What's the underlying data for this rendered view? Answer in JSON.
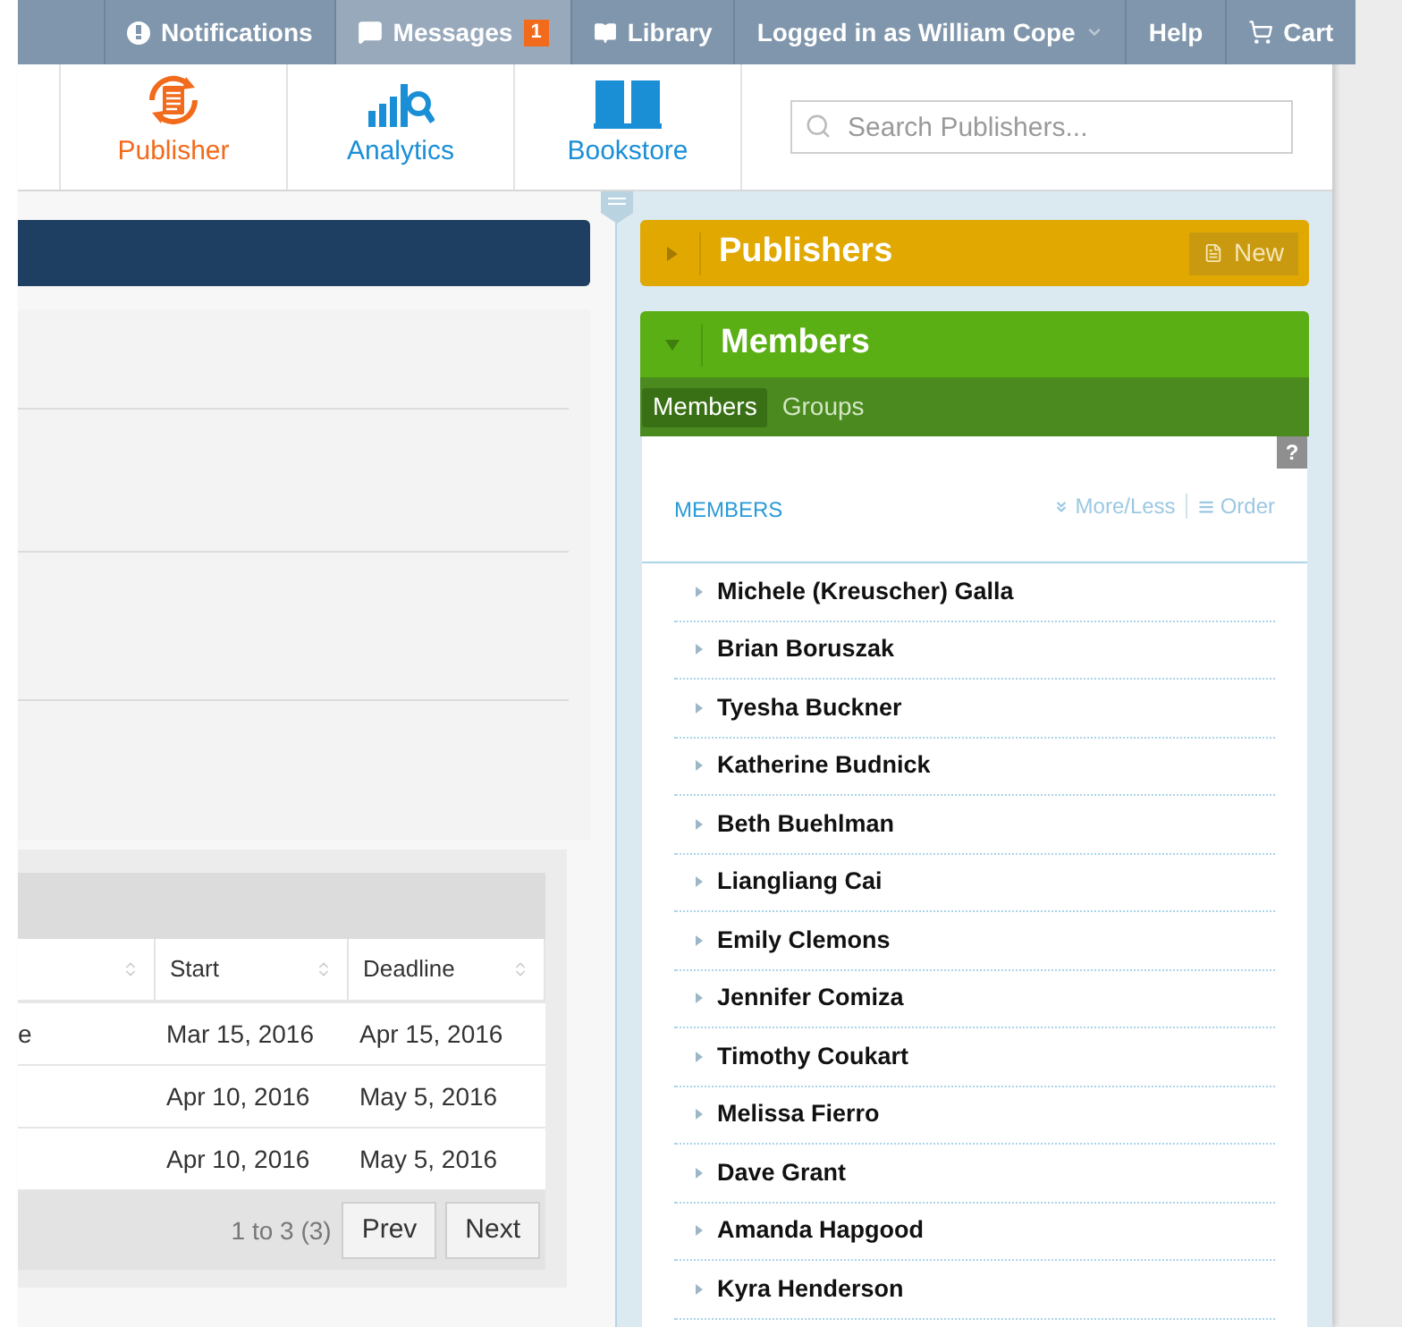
{
  "top_bar": {
    "items": [
      {
        "kind": "notifications",
        "label": "Notifications",
        "selected": false
      },
      {
        "kind": "messages",
        "label": "Messages",
        "badge": "1",
        "selected": true
      },
      {
        "kind": "library",
        "label": "Library",
        "selected": false
      },
      {
        "kind": "user",
        "label": "Logged in as William Cope",
        "selected": false
      },
      {
        "kind": "help",
        "label": "Help",
        "selected": false
      },
      {
        "kind": "cart",
        "label": "Cart",
        "selected": false
      }
    ]
  },
  "nav": {
    "items": [
      {
        "kind": "publisher",
        "label": "Publisher",
        "selected": true
      },
      {
        "kind": "analytics",
        "label": "Analytics",
        "selected": false
      },
      {
        "kind": "bookstore",
        "label": "Bookstore",
        "selected": false
      }
    ],
    "search": {
      "placeholder": "Search Publishers..."
    }
  },
  "table": {
    "columns": [
      "Start",
      "Deadline"
    ],
    "rows": [
      {
        "column_1": "e",
        "start": "Mar 15, 2016",
        "deadline": "Apr 15, 2016"
      },
      {
        "start": "Apr 10, 2016",
        "deadline": "May 5, 2016"
      },
      {
        "start": "Apr 10, 2016",
        "deadline": "May 5, 2016"
      }
    ],
    "range": "1 to 3 (3)",
    "buttons": [
      "Prev",
      "Next"
    ]
  },
  "publishers_panel": {
    "title": "Publishers",
    "expanded": false,
    "button": "New"
  },
  "members_panel": {
    "title": "Members",
    "expanded": true,
    "tabs": [
      {
        "label": "Members",
        "selected": true
      },
      {
        "label": "Groups",
        "selected": false
      }
    ],
    "help": "?",
    "heading": "MEMBERS",
    "more_less": "More/Less",
    "order": "Order",
    "members": [
      "Michele (Kreuscher) Galla",
      "Brian Boruszak",
      "Tyesha Buckner",
      "Katherine Budnick",
      "Beth Buehlman",
      "Liangliang Cai",
      "Emily Clemons",
      "Jennifer Comiza",
      "Timothy Coukart",
      "Melissa Fierro",
      "Dave Grant",
      "Amanda Hapgood",
      "Kyra Henderson"
    ]
  }
}
